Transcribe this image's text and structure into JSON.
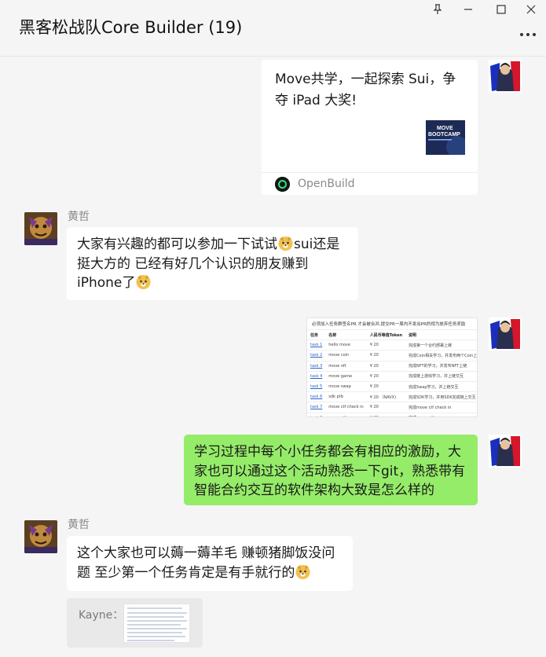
{
  "window": {
    "title": "黑客松战队Core Builder (19)",
    "controls": [
      "pin-icon",
      "minimize-icon",
      "maximize-icon",
      "close-icon"
    ],
    "more_icon": "more-icon"
  },
  "messages": {
    "m1": {
      "card_title": "Move共学，一起探索 Sui，争夺 iPad 大奖!",
      "thumb_text_1": "MOVE",
      "thumb_text_2": "BOOTCAMP",
      "source": "OpenBuild"
    },
    "m2": {
      "sender": "黄哲",
      "line1_a": "大家有兴趣的都可以参加一下试试",
      "line1_b": "sui还是",
      "line2": "挺大方的 已经有好几个认识的朋友赚到",
      "line3": "iPhone了"
    },
    "m3": {
      "image_title": "必须加入任务群签名PR 才会被合并,提交PR一周内不发出PR的视为放弃任务奖励",
      "headers": [
        "任务",
        "名称",
        "人民币等值Token",
        "说明"
      ],
      "rows": [
        [
          "task 1",
          "hello move",
          "¥ 20",
          "完成第一个合约部署上链"
        ],
        [
          "task 2",
          "move coin",
          "¥ 20",
          "完成Coin相关学习，并发布两个Coin上链"
        ],
        [
          "task 3",
          "move nft",
          "¥ 20",
          "完成NFT的学习，并发布NFT上链"
        ],
        [
          "task 4",
          "move game",
          "¥ 20",
          "完成链上游戏学习，并上链交互"
        ],
        [
          "task 5",
          "move swap",
          "¥ 20",
          "完成Swap学习，并上链交互"
        ],
        [
          "task 6",
          "sdk ptb",
          "¥ 20 （NAVX)",
          "完成SDK学习，并用SDK完成链上交互"
        ],
        [
          "task 7",
          "move ctf check in",
          "¥ 20",
          "完成move ctf check in"
        ],
        [
          "task 8",
          "move ctf pow",
          "¥ 20",
          "完成move ctf pow"
        ],
        [
          "defi",
          "defi",
          "35SUI",
          "完成Defi学习挑战"
        ]
      ]
    },
    "m4": {
      "text": "学习过程中每个小任务都会有相应的激励，大家也可以通过这个活动熟悉一下git，熟悉带有智能合约交互的软件架构大致是怎么样的"
    },
    "m5": {
      "sender": "黄哲",
      "line1": "这个大家也可以薅一薅羊毛 赚顿猪脚饭没问",
      "line2": "题 至少第一个任务肯定是有手就行的",
      "quote_label": "Kayne："
    }
  },
  "colors": {
    "bg": "#f5f5f5",
    "bubble_self": "#95ec69",
    "bubble_other": "#ffffff",
    "link": "#2a62c9"
  }
}
